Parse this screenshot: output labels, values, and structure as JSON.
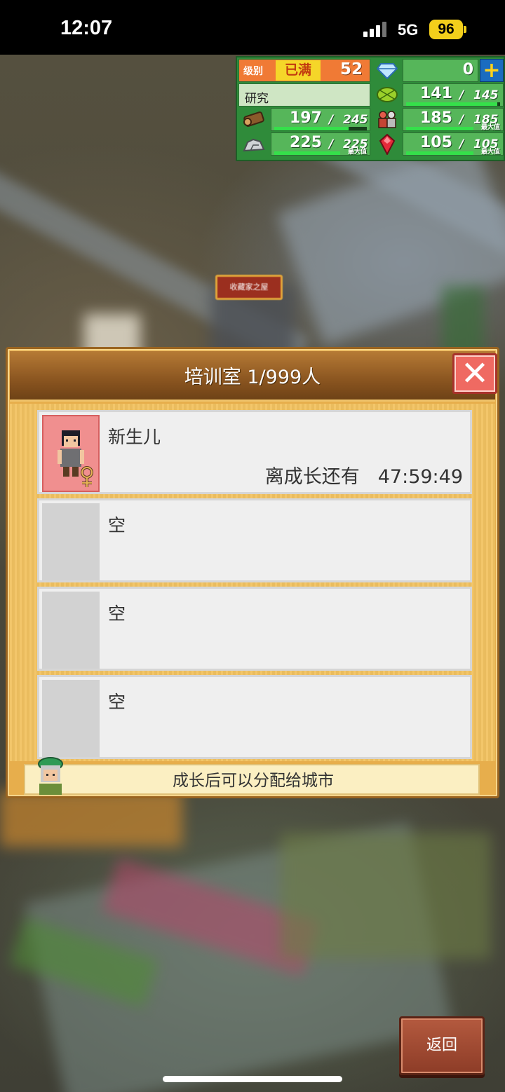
{
  "status_bar": {
    "time": "12:07",
    "network": "5G",
    "battery": "96"
  },
  "hud": {
    "level_label": "级别",
    "level_status": "已满",
    "level_value": "52",
    "gems": "0",
    "research_label": "研究",
    "food_current": "141",
    "food_max": "145",
    "food_fraction": 0.97,
    "wood_current": "197",
    "wood_max": "245",
    "wood_fraction": 0.8,
    "people_current": "185",
    "people_max": "185",
    "people_fraction": 1.0,
    "stone_current": "225",
    "stone_max": "225",
    "stone_fraction": 1.0,
    "ruby_current": "105",
    "ruby_max": "105",
    "ruby_fraction": 1.0,
    "max_tag": "最大值",
    "separator": "/",
    "colors": {
      "panel": "#2f8b3a",
      "cell": "#56b65a",
      "accent": "#f07a35",
      "bar": "#35e04a"
    }
  },
  "world": {
    "building_sign": "收藏家之屋"
  },
  "dialog": {
    "title": "培训室 1/999人",
    "close_symbol": "✕",
    "slots": [
      {
        "name": "新生儿",
        "countdown_label": "离成长还有",
        "countdown_value": "47:59:49",
        "occupied": true
      },
      {
        "name": "空",
        "occupied": false
      },
      {
        "name": "空",
        "occupied": false
      },
      {
        "name": "空",
        "occupied": false
      }
    ],
    "hint": "成长后可以分配给城市"
  },
  "back_button": {
    "label": "返回"
  }
}
